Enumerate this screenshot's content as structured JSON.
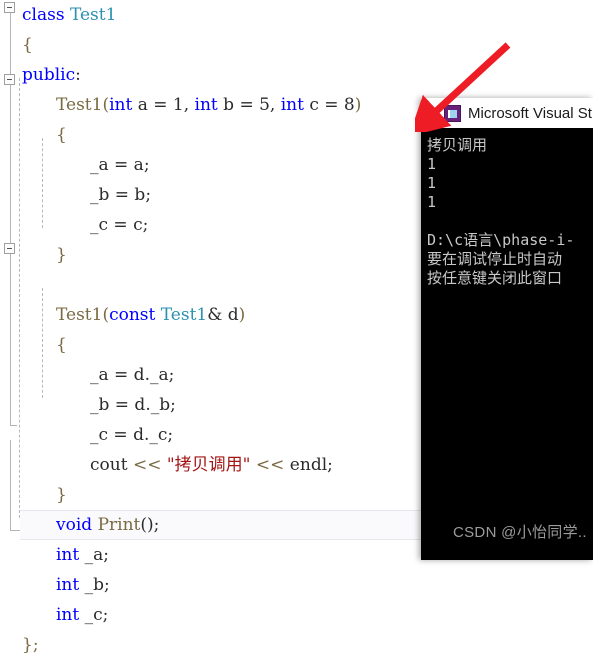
{
  "editor": {
    "name": "code-editor",
    "background": "#ffffff",
    "colors": {
      "keyword": "#0000ff",
      "type": "#2b91af",
      "function": "#7a6a42",
      "string": "#a31515",
      "plain": "#2b2b2b"
    },
    "lines": [
      {
        "indent": 0,
        "fold": "collapsible",
        "tokens": [
          {
            "t": "class ",
            "c": "kw"
          },
          {
            "t": "Test1",
            "c": "type"
          }
        ]
      },
      {
        "indent": 0,
        "fold": "none",
        "tokens": [
          {
            "t": "{",
            "c": "punct"
          }
        ]
      },
      {
        "indent": 0,
        "fold": "none",
        "tokens": [
          {
            "t": "public",
            "c": "kw"
          },
          {
            "t": ":",
            "c": "plain"
          }
        ]
      },
      {
        "indent": 1,
        "fold": "collapsible",
        "tokens": [
          {
            "t": "Test1",
            "c": "fn"
          },
          {
            "t": "(",
            "c": "punct"
          },
          {
            "t": "int",
            "c": "kw"
          },
          {
            "t": " a = 1, ",
            "c": "plain"
          },
          {
            "t": "int",
            "c": "kw"
          },
          {
            "t": " b = 5, ",
            "c": "plain"
          },
          {
            "t": "int",
            "c": "kw"
          },
          {
            "t": " c = 8",
            "c": "plain"
          },
          {
            "t": ")",
            "c": "punct"
          }
        ]
      },
      {
        "indent": 1,
        "fold": "none",
        "tokens": [
          {
            "t": "{",
            "c": "punct"
          }
        ]
      },
      {
        "indent": 2,
        "fold": "none",
        "tokens": [
          {
            "t": "_a = a;",
            "c": "plain"
          }
        ]
      },
      {
        "indent": 2,
        "fold": "none",
        "tokens": [
          {
            "t": "_b = b;",
            "c": "plain"
          }
        ]
      },
      {
        "indent": 2,
        "fold": "none",
        "tokens": [
          {
            "t": "_c = c;",
            "c": "plain"
          }
        ]
      },
      {
        "indent": 1,
        "fold": "none",
        "tokens": [
          {
            "t": "}",
            "c": "punct"
          }
        ]
      },
      {
        "indent": 0,
        "fold": "none",
        "tokens": [
          {
            "t": "",
            "c": "plain"
          }
        ]
      },
      {
        "indent": 1,
        "fold": "collapsible",
        "tokens": [
          {
            "t": "Test1",
            "c": "fn"
          },
          {
            "t": "(",
            "c": "punct"
          },
          {
            "t": "const",
            "c": "kw"
          },
          {
            "t": " ",
            "c": "plain"
          },
          {
            "t": "Test1",
            "c": "type"
          },
          {
            "t": "& d",
            "c": "plain"
          },
          {
            "t": ")",
            "c": "punct"
          }
        ]
      },
      {
        "indent": 1,
        "fold": "none",
        "tokens": [
          {
            "t": "{",
            "c": "punct"
          }
        ]
      },
      {
        "indent": 2,
        "fold": "none",
        "tokens": [
          {
            "t": "_a = d._a;",
            "c": "plain"
          }
        ]
      },
      {
        "indent": 2,
        "fold": "none",
        "tokens": [
          {
            "t": "_b = d._b;",
            "c": "plain"
          }
        ]
      },
      {
        "indent": 2,
        "fold": "none",
        "tokens": [
          {
            "t": "_c = d._c;",
            "c": "plain"
          }
        ]
      },
      {
        "indent": 2,
        "fold": "none",
        "tokens": [
          {
            "t": "cout ",
            "c": "plain"
          },
          {
            "t": "<<",
            "c": "op"
          },
          {
            "t": " ",
            "c": "plain"
          },
          {
            "t": "\"拷贝调用\"",
            "c": "str"
          },
          {
            "t": " ",
            "c": "plain"
          },
          {
            "t": "<<",
            "c": "op"
          },
          {
            "t": " endl;",
            "c": "plain"
          }
        ]
      },
      {
        "indent": 1,
        "fold": "none",
        "tokens": [
          {
            "t": "}",
            "c": "punct"
          }
        ]
      },
      {
        "indent": 1,
        "fold": "none",
        "tokens": [
          {
            "t": "void",
            "c": "kw"
          },
          {
            "t": " ",
            "c": "plain"
          },
          {
            "t": "Print",
            "c": "fn"
          },
          {
            "t": "();",
            "c": "plain"
          }
        ]
      },
      {
        "indent": 1,
        "fold": "none",
        "tokens": [
          {
            "t": "int",
            "c": "kw"
          },
          {
            "t": " _a;",
            "c": "plain"
          }
        ]
      },
      {
        "indent": 1,
        "fold": "none",
        "tokens": [
          {
            "t": "int",
            "c": "kw"
          },
          {
            "t": " _b;",
            "c": "plain"
          }
        ]
      },
      {
        "indent": 1,
        "fold": "none",
        "tokens": [
          {
            "t": "int",
            "c": "kw"
          },
          {
            "t": " _c;",
            "c": "plain"
          }
        ]
      },
      {
        "indent": 0,
        "fold": "none",
        "current": true,
        "tokens": [
          {
            "t": "};",
            "c": "punct"
          }
        ]
      }
    ]
  },
  "console": {
    "name": "console-window",
    "title": "Microsoft Visual St",
    "icon": "visual-studio-icon",
    "background": "#000000",
    "text_color": "#c8c8c8",
    "lines": [
      "拷贝调用",
      "1",
      "1",
      "1",
      "",
      "D:\\c语言\\phase-i-",
      "要在调试停止时自动",
      "按任意键关闭此窗口"
    ]
  },
  "annotation": {
    "name": "red-arrow",
    "color": "#ee1c24",
    "points_to": "console-window-titlebar"
  },
  "watermark": {
    "text": "CSDN @小怡同学..",
    "color": "#9b9b9b"
  }
}
